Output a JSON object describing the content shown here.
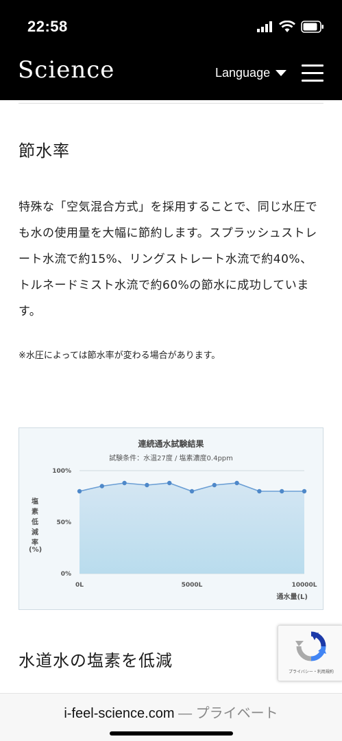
{
  "status_bar": {
    "time": "22:58",
    "icons": [
      "signal-icon",
      "wifi-icon",
      "battery-icon"
    ]
  },
  "header": {
    "logo": "Science",
    "language_label": "Language",
    "menu_icon": "hamburger-menu-icon"
  },
  "section1": {
    "heading": "節水率",
    "paragraph": "特殊な「空気混合方式」を採用することで、同じ水圧でも水の使用量を大幅に節約します。スプラッシュストレート水流で約15%、リングストレート水流で約40%、トルネードミスト水流で約60%の節水に成功しています。",
    "note": "※水圧によっては節水率が変わる場合があります。"
  },
  "chart_data": {
    "type": "line",
    "title": "連続通水試験結果",
    "subtitle": "試験条件：水温27度 / 塩素濃度0.4ppm",
    "ylabel": "塩素低減率",
    "yunit": "(%)",
    "xlabel": "通水量(L)",
    "x_tick_labels": [
      "0L",
      "5000L",
      "10000L"
    ],
    "y_tick_labels": [
      "100%",
      "50%",
      "0%"
    ],
    "xlim": [
      0,
      10000
    ],
    "ylim": [
      0,
      100
    ],
    "series": [
      {
        "x": [
          0,
          1000,
          2000,
          3000,
          4000,
          5000,
          6000,
          7000,
          8000,
          9000,
          10000
        ],
        "values": [
          80,
          85,
          88,
          86,
          88,
          80,
          86,
          88,
          80,
          80,
          80
        ]
      }
    ],
    "colors": {
      "line": "#6a9ed4",
      "marker": "#4e88c9",
      "fill_top": "#d4e6f3",
      "fill_bottom": "#b9dced"
    },
    "grid": true
  },
  "section2": {
    "heading": "水道水の塩素を低減"
  },
  "recaptcha": {
    "caption": "プライバシー・利用規約"
  },
  "browser": {
    "domain": "i-feel-science.com",
    "separator": " — ",
    "mode": "プライベート"
  }
}
